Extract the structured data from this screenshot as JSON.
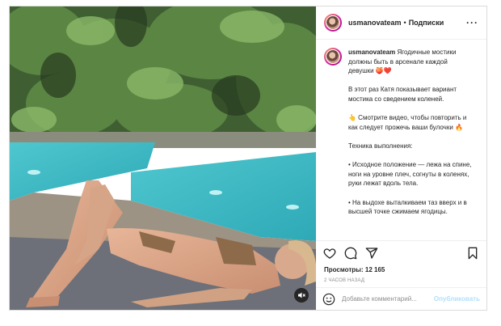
{
  "header": {
    "username": "usmanovateam",
    "separator": "•",
    "follow_label": "Подписки",
    "more_label": "···"
  },
  "caption": {
    "username": "usmanovateam",
    "line1": "Ягодичные мостики должны быть в арсенале каждой девушки 🍑❤️",
    "para2": "В этот раз Катя показывает вариант мостика со сведением коленей.",
    "para3": "👆 Смотрите видео, чтобы повторить и как следует прожечь ваши булочки 🔥",
    "para4": "Техника выполнения:",
    "para5": "• Исходное положение — лежа на спине, ноги на уровне плеч, согнуты в коленях, руки лежат вдоль тела.",
    "para6": "• На выдохе выталкиваем таз вверх и в высшей точке сжимаем ягодицы."
  },
  "actions": {
    "like_icon": "heart-icon",
    "comment_icon": "comment-icon",
    "share_icon": "paper-plane-icon",
    "save_icon": "bookmark-icon"
  },
  "stats": {
    "views": "Просмотры: 12 165",
    "time": "2 часов назад"
  },
  "comment_box": {
    "placeholder": "Добавьте комментарий...",
    "post_label": "Опубликовать",
    "emoji_icon": "smiley-icon"
  },
  "media": {
    "mute_icon": "speaker-muted-icon"
  },
  "colors": {
    "border": "#dbdbdb",
    "post_button_disabled": "#b2dffc",
    "secondary_text": "#8e8e8e"
  }
}
